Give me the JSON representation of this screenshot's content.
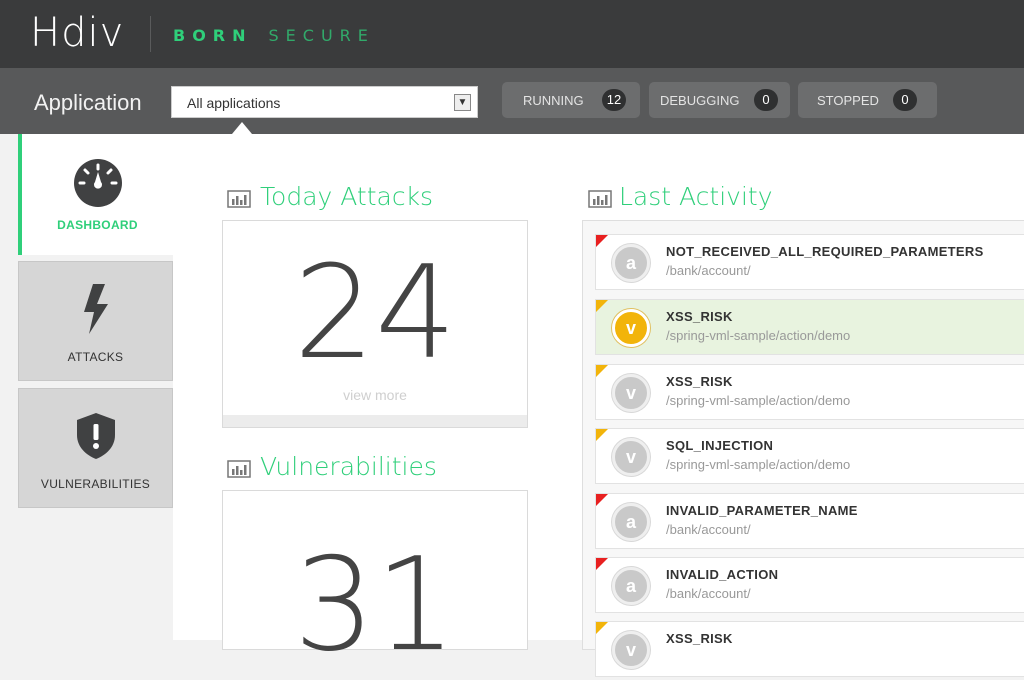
{
  "brand": {
    "logo": "Hdiv",
    "tagline_1": "BORN",
    "tagline_2": "SECURE"
  },
  "appbar": {
    "label": "Application",
    "select_value": "All applications",
    "pills": [
      {
        "label": "RUNNING",
        "count": "12"
      },
      {
        "label": "DEBUGGING",
        "count": "0"
      },
      {
        "label": "STOPPED",
        "count": "0"
      }
    ]
  },
  "sidebar": {
    "items": [
      {
        "label": "DASHBOARD",
        "icon": "gauge-icon",
        "active": true
      },
      {
        "label": "ATTACKS",
        "icon": "lightning-icon",
        "active": false
      },
      {
        "label": "VULNERABILITIES",
        "icon": "shield-alert-icon",
        "active": false
      }
    ]
  },
  "today_attacks": {
    "title": "Today Attacks",
    "count": "24",
    "view_more": "view more"
  },
  "vulnerabilities": {
    "title": "Vulnerabilities",
    "count": "31"
  },
  "last_activity": {
    "title": "Last Activity",
    "rows": [
      {
        "letter": "a",
        "name": "NOT_RECEIVED_ALL_REQUIRED_PARAMETERS",
        "path": "/bank/account/",
        "flag": "red",
        "highlight": false
      },
      {
        "letter": "v",
        "name": "XSS_RISK",
        "path": "/spring-vml-sample/action/demo",
        "flag": "yellow",
        "highlight": true
      },
      {
        "letter": "v",
        "name": "XSS_RISK",
        "path": "/spring-vml-sample/action/demo",
        "flag": "yellow",
        "highlight": false
      },
      {
        "letter": "v",
        "name": "SQL_INJECTION",
        "path": "/spring-vml-sample/action/demo",
        "flag": "yellow",
        "highlight": false
      },
      {
        "letter": "a",
        "name": "INVALID_PARAMETER_NAME",
        "path": "/bank/account/",
        "flag": "red",
        "highlight": false
      },
      {
        "letter": "a",
        "name": "INVALID_ACTION",
        "path": "/bank/account/",
        "flag": "red",
        "highlight": false
      },
      {
        "letter": "v",
        "name": "XSS_RISK",
        "path": "",
        "flag": "yellow",
        "highlight": false
      }
    ]
  },
  "colors": {
    "accent": "#2fcf7a",
    "topbar": "#3a3b3c",
    "appbar": "#58595a",
    "flag_red": "#e82020",
    "flag_yellow": "#f2b40a"
  }
}
